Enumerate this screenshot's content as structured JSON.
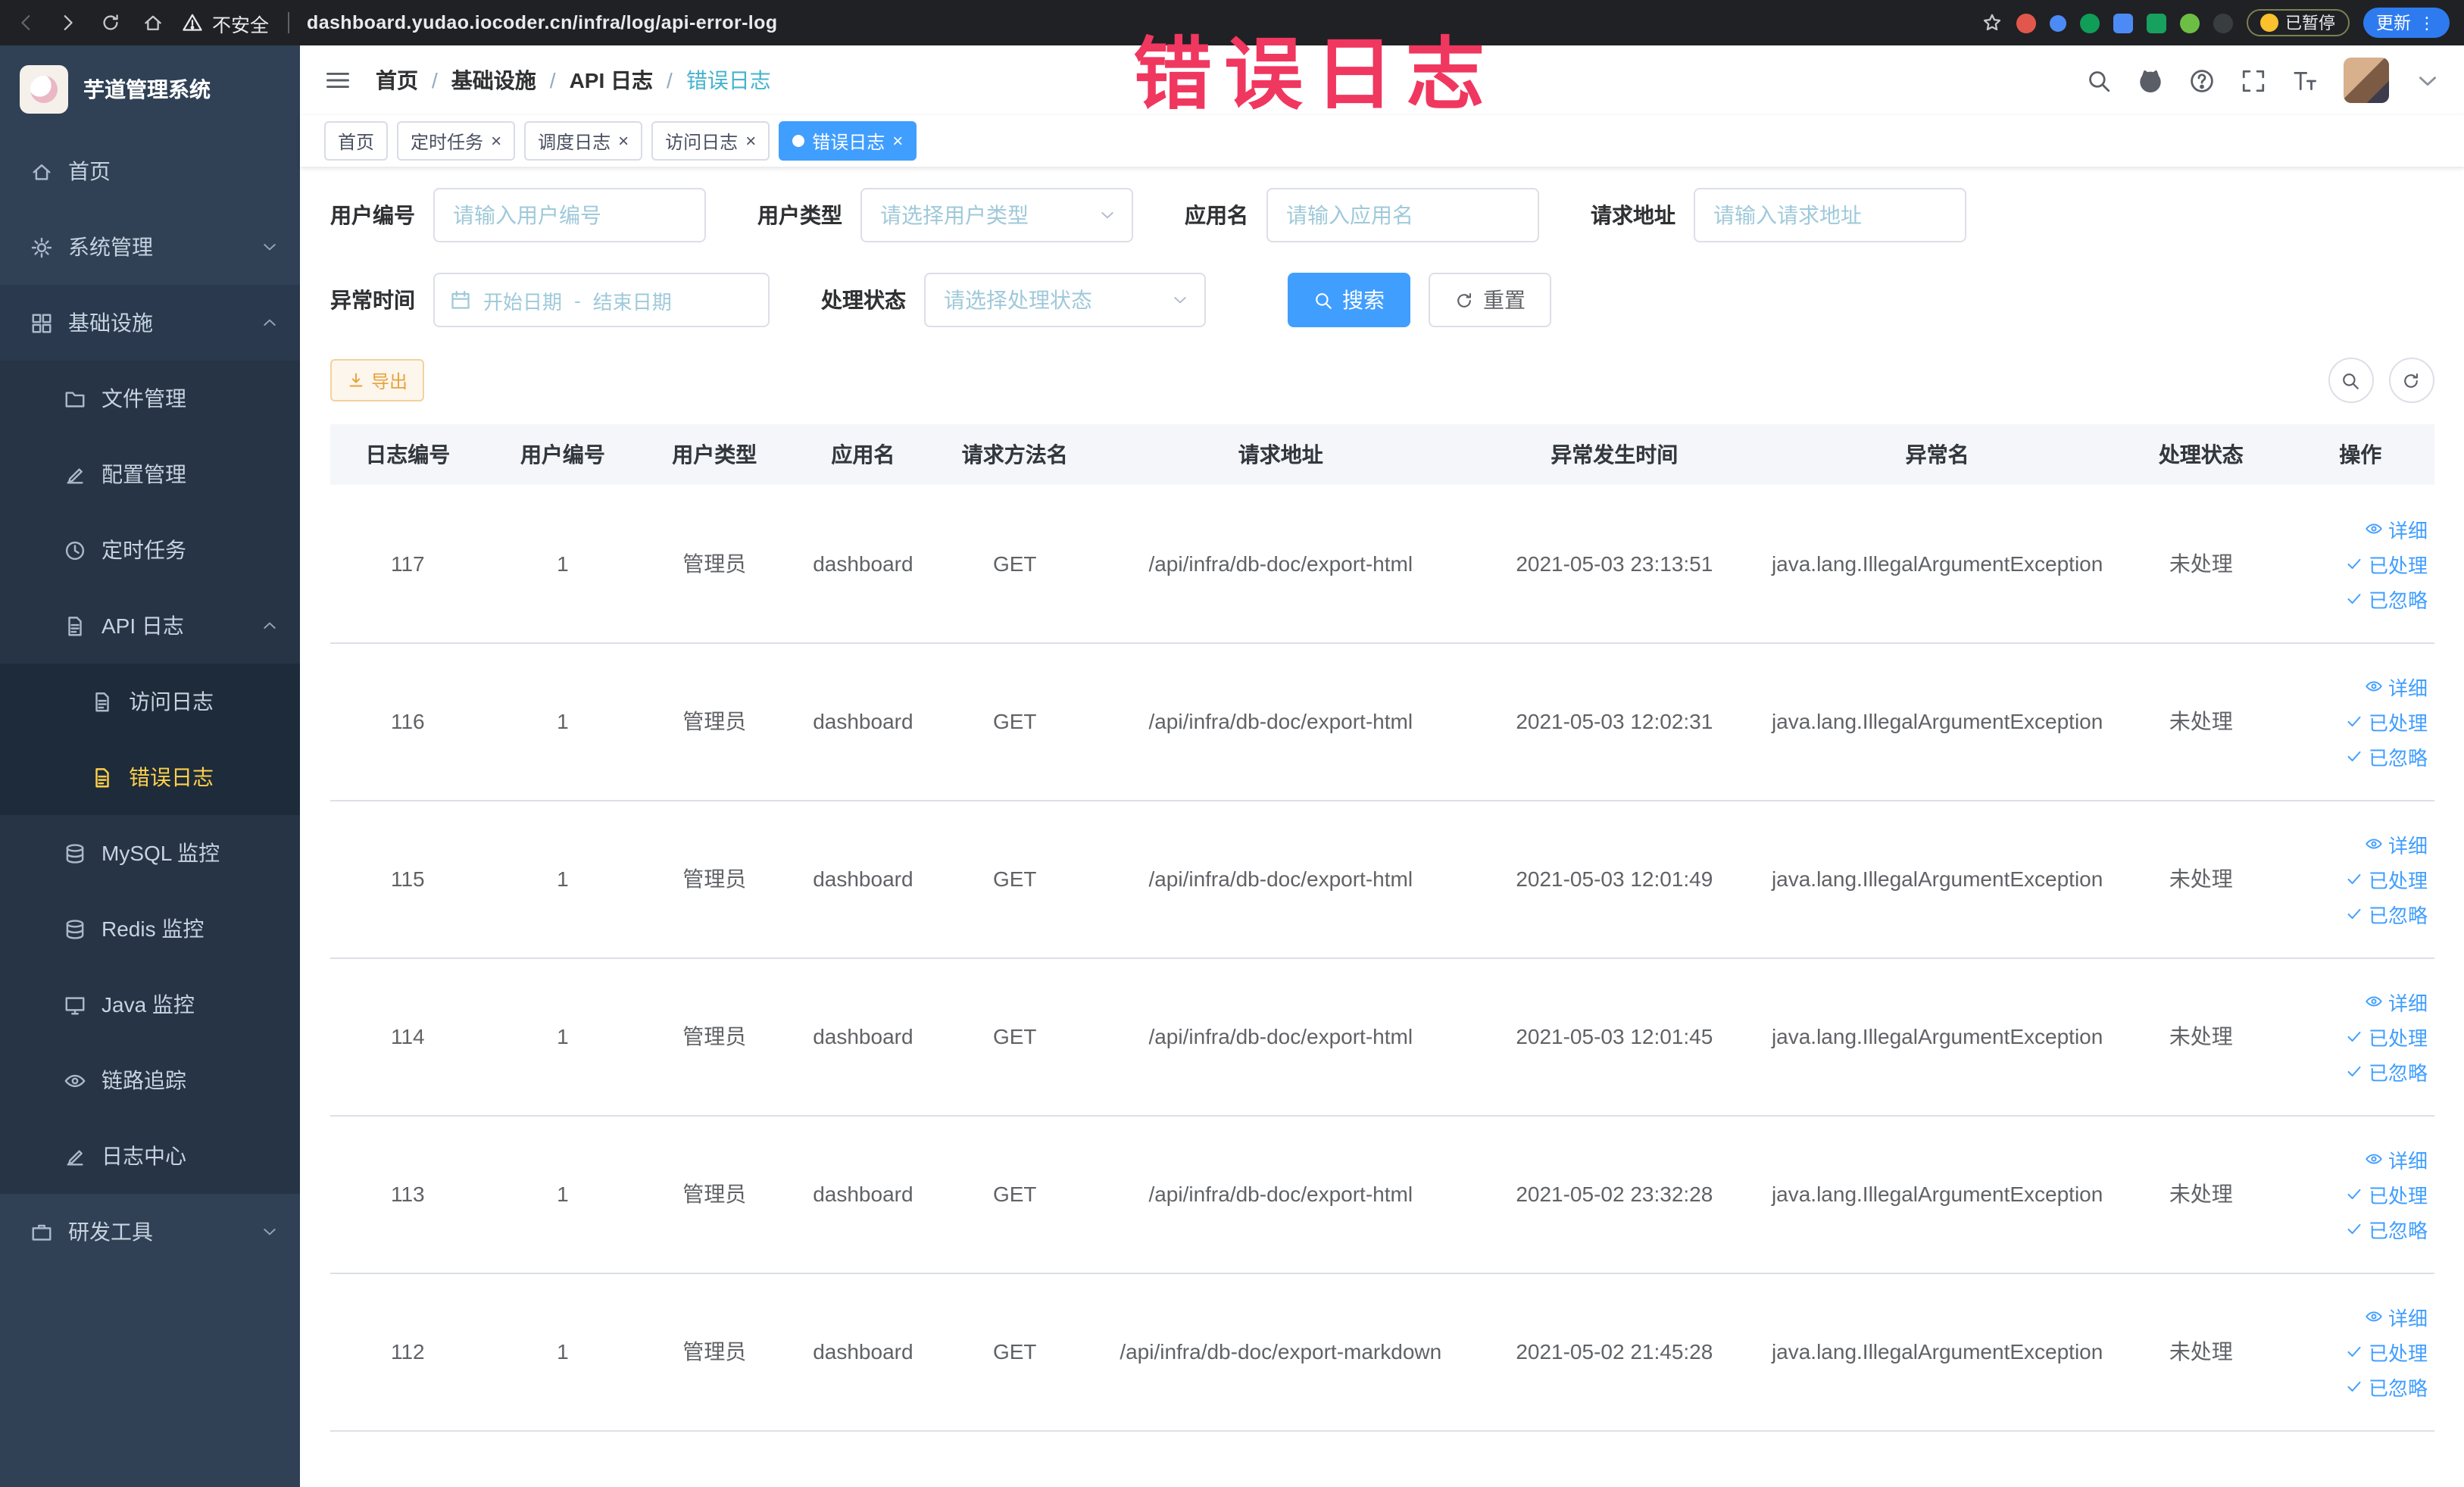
{
  "annotation": {
    "text": "错误日志"
  },
  "browser": {
    "security_label": "不安全",
    "url": "dashboard.yudao.iocoder.cn/infra/log/api-error-log",
    "paused_badge": "已暂停",
    "update_label": "更新"
  },
  "sidebar": {
    "app_title": "芋道管理系统",
    "menu": [
      {
        "label": "首页",
        "icon": "home",
        "depth": 0
      },
      {
        "label": "系统管理",
        "icon": "gear",
        "depth": 0,
        "arrow": "down"
      },
      {
        "label": "基础设施",
        "icon": "grid",
        "depth": 0,
        "arrow": "up",
        "open": true
      },
      {
        "label": "文件管理",
        "icon": "folder",
        "depth": 1
      },
      {
        "label": "配置管理",
        "icon": "edit",
        "depth": 1
      },
      {
        "label": "定时任务",
        "icon": "clock",
        "depth": 1
      },
      {
        "label": "API 日志",
        "icon": "doc",
        "depth": 1,
        "arrow": "up"
      },
      {
        "label": "访问日志",
        "icon": "doc",
        "depth": 2
      },
      {
        "label": "错误日志",
        "icon": "doc",
        "depth": 2,
        "active": true
      },
      {
        "label": "MySQL 监控",
        "icon": "db",
        "depth": 1
      },
      {
        "label": "Redis 监控",
        "icon": "db",
        "depth": 1
      },
      {
        "label": "Java 监控",
        "icon": "monitor",
        "depth": 1
      },
      {
        "label": "链路追踪",
        "icon": "eye",
        "depth": 1
      },
      {
        "label": "日志中心",
        "icon": "edit",
        "depth": 1
      },
      {
        "label": "研发工具",
        "icon": "tools",
        "depth": 0,
        "arrow": "down"
      }
    ]
  },
  "breadcrumb": [
    "首页",
    "基础设施",
    "API 日志",
    "错误日志"
  ],
  "tabs": [
    {
      "label": "首页",
      "closable": false,
      "active": false
    },
    {
      "label": "定时任务",
      "closable": true,
      "active": false
    },
    {
      "label": "调度日志",
      "closable": true,
      "active": false
    },
    {
      "label": "访问日志",
      "closable": true,
      "active": false
    },
    {
      "label": "错误日志",
      "closable": true,
      "active": true
    }
  ],
  "filters": {
    "user_id_label": "用户编号",
    "user_id_placeholder": "请输入用户编号",
    "user_type_label": "用户类型",
    "user_type_placeholder": "请选择用户类型",
    "app_name_label": "应用名",
    "app_name_placeholder": "请输入应用名",
    "request_url_label": "请求地址",
    "request_url_placeholder": "请输入请求地址",
    "exception_time_label": "异常时间",
    "start_date_placeholder": "开始日期",
    "date_separator": "-",
    "end_date_placeholder": "结束日期",
    "process_status_label": "处理状态",
    "process_status_placeholder": "请选择处理状态",
    "search_button": "搜索",
    "reset_button": "重置"
  },
  "toolbar": {
    "export_button": "导出"
  },
  "table": {
    "headers": [
      "日志编号",
      "用户编号",
      "用户类型",
      "应用名",
      "请求方法名",
      "请求地址",
      "异常发生时间",
      "异常名",
      "处理状态",
      "操作"
    ],
    "actions": [
      {
        "label": "详细",
        "icon": "eye",
        "name": "detail"
      },
      {
        "label": "已处理",
        "icon": "check",
        "name": "processed"
      },
      {
        "label": "已忽略",
        "icon": "check",
        "name": "ignored"
      }
    ],
    "rows": [
      {
        "cells": [
          "117",
          "1",
          "管理员",
          "dashboard",
          "GET",
          "/api/infra/db-doc/export-html",
          "2021-05-03 23:13:51",
          "java.lang.IllegalArgumentException",
          "未处理"
        ]
      },
      {
        "cells": [
          "116",
          "1",
          "管理员",
          "dashboard",
          "GET",
          "/api/infra/db-doc/export-html",
          "2021-05-03 12:02:31",
          "java.lang.IllegalArgumentException",
          "未处理"
        ]
      },
      {
        "cells": [
          "115",
          "1",
          "管理员",
          "dashboard",
          "GET",
          "/api/infra/db-doc/export-html",
          "2021-05-03 12:01:49",
          "java.lang.IllegalArgumentException",
          "未处理"
        ]
      },
      {
        "cells": [
          "114",
          "1",
          "管理员",
          "dashboard",
          "GET",
          "/api/infra/db-doc/export-html",
          "2021-05-03 12:01:45",
          "java.lang.IllegalArgumentException",
          "未处理"
        ]
      },
      {
        "cells": [
          "113",
          "1",
          "管理员",
          "dashboard",
          "GET",
          "/api/infra/db-doc/export-html",
          "2021-05-02 23:32:28",
          "java.lang.IllegalArgumentException",
          "未处理"
        ]
      },
      {
        "cells": [
          "112",
          "1",
          "管理员",
          "dashboard",
          "GET",
          "/api/infra/db-doc/export-markdown",
          "2021-05-02 21:45:28",
          "java.lang.IllegalArgumentException",
          "未处理"
        ]
      }
    ]
  },
  "colors": {
    "accent": "#409eff",
    "sidebar_bg": "#304156",
    "sidebar_active_text": "#ffd04b",
    "warning": "#e6a23c",
    "annotation": "#f0375f",
    "placeholder_teal": "#9fc9da"
  }
}
